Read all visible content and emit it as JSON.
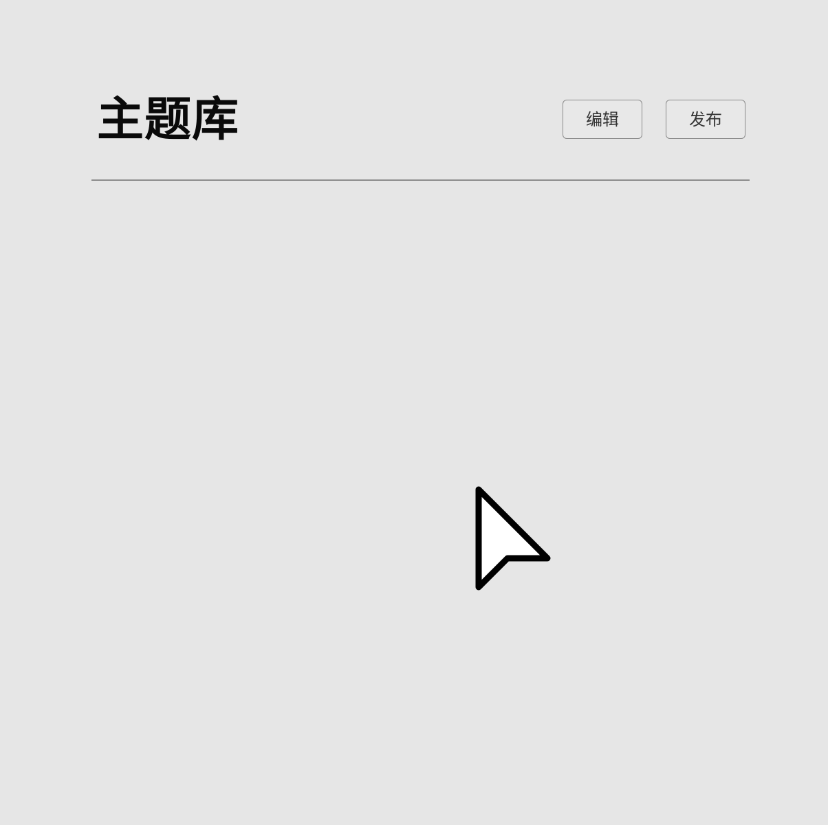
{
  "page": {
    "title": "主题库"
  },
  "toolbar": {
    "edit_label": "编辑",
    "publish_label": "发布"
  },
  "cursor": {
    "icon": "arrow-cursor-icon"
  },
  "colors": {
    "background": "#e6e6e6",
    "text_primary": "#0a0a0a",
    "button_border": "#8a8a8a",
    "divider": "#8d8d8d"
  }
}
